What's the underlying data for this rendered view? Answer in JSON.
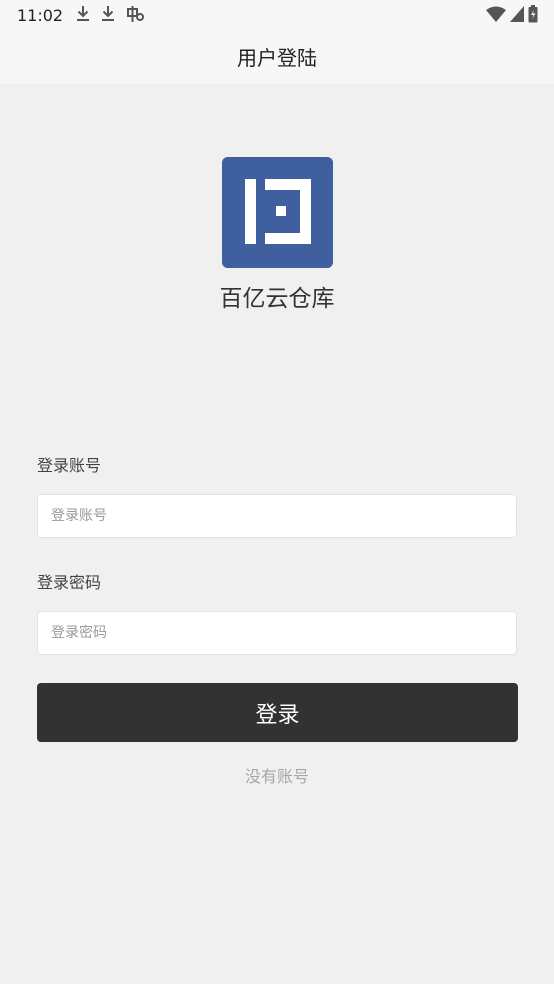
{
  "status_bar": {
    "time": "11:02",
    "left_icons": [
      "download-icon",
      "download-icon",
      "app-notification-icon"
    ],
    "right_icons": [
      "wifi-icon",
      "cell-signal-icon",
      "battery-icon"
    ]
  },
  "app_bar": {
    "title": "用户登陆"
  },
  "brand": {
    "app_name": "百亿云仓库",
    "logo_color": "#3f5f9f"
  },
  "form": {
    "account": {
      "label": "登录账号",
      "placeholder": "登录账号",
      "value": ""
    },
    "password": {
      "label": "登录密码",
      "placeholder": "登录密码",
      "value": ""
    },
    "submit_label": "登录",
    "submit_color": "#323232",
    "no_account_link": "没有账号"
  }
}
